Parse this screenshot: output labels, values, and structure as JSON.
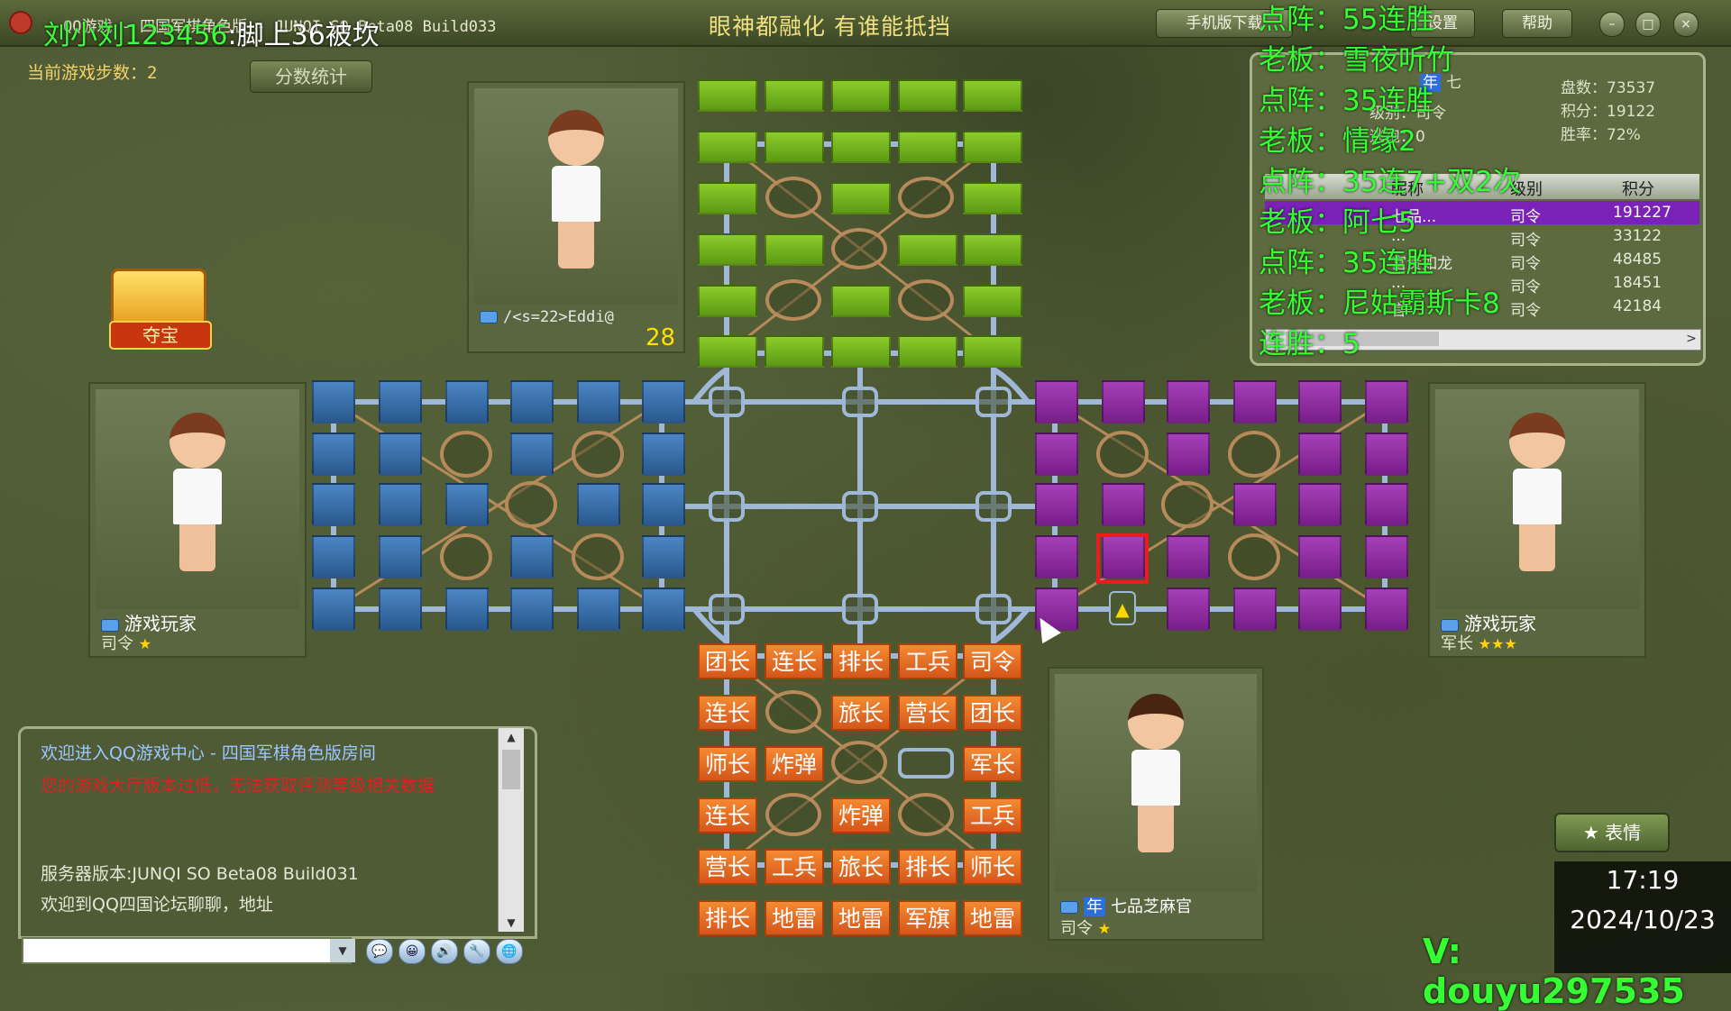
{
  "titlebar": {
    "title": "QQ游戏 - 四国军棋角色版 - JUNQI SO Beta08 Build033",
    "slogan": "眼神都融化 有谁能抵挡",
    "mobile_btn": "手机版下载",
    "settings_btn": "设置",
    "help_btn": "帮助",
    "minimize": "–",
    "maximize": "□",
    "close": "×"
  },
  "overlay_name": {
    "user": "刘小刘123456",
    "note": ":脚上36被坎"
  },
  "game": {
    "step_label": "当前游戏步数：2",
    "score_btn": "分数统计",
    "treasure_label": "夺宝"
  },
  "players": {
    "top": {
      "name": "/<s=22>Eddi@",
      "timer": "28"
    },
    "left": {
      "name": "游戏玩家",
      "rank": "司令"
    },
    "right": {
      "name": "游戏玩家",
      "rank": "军长"
    },
    "bottom": {
      "name": "七品芝麻官",
      "rank": "司令",
      "badge": "年"
    }
  },
  "board": {
    "rows": [
      [
        "团长",
        "连长",
        "排长",
        "工兵",
        "司令"
      ],
      [
        "连长",
        "",
        "旅长",
        "营长",
        "团长"
      ],
      [
        "师长",
        "炸弹",
        "",
        "",
        "军长"
      ],
      [
        "连长",
        "",
        "炸弹",
        "",
        "工兵"
      ],
      [
        "营长",
        "工兵",
        "旅长",
        "排长",
        "师长"
      ],
      [
        "排长",
        "地雷",
        "地雷",
        "军旗",
        "地雷"
      ]
    ]
  },
  "stats": {
    "name": "七",
    "badge": "年",
    "level": "级别：司令",
    "escapes": "逃跑：0",
    "games": "盘数：73537",
    "points": "积分：19122",
    "winrate": "胜率：72%",
    "columns": [
      "昵称",
      "级别",
      "积分"
    ],
    "rows": [
      {
        "name": "七品...",
        "rank": "司令",
        "score": "191227"
      },
      {
        "name": "...",
        "rank": "司令",
        "score": "33122"
      },
      {
        "name": "富贵如龙",
        "rank": "司令",
        "score": "48485"
      },
      {
        "name": "...",
        "rank": "司令",
        "score": "18451"
      },
      {
        "name": "言",
        "rank": "司令",
        "score": "42184"
      }
    ]
  },
  "streamer_lines": [
    "点阵：55连胜",
    "老板：雪夜听竹",
    "点阵：35连胜",
    "老板：情缘2",
    "点阵：35连7+双2次",
    "老板：阿七5",
    "点阵：35连胜",
    "老板：尼姑霸斯卡8",
    "连胜：5"
  ],
  "chat": {
    "welcome": "欢迎进入QQ游戏中心 - 四国军棋角色版房间",
    "warning": "您的游戏大厅版本过低，无法获取评测等级相关数据",
    "server": "服务器版本:JUNQI SO Beta08 Build031",
    "forum": "欢迎到QQ四国论坛聊聊，地址",
    "tools": [
      "💬",
      "😀",
      "🔊",
      "🔧",
      "🌐"
    ]
  },
  "emote_btn": "★ 表情",
  "clock": {
    "time": "17:19",
    "date": "2024/10/23"
  },
  "contact": "V: douyu297535"
}
